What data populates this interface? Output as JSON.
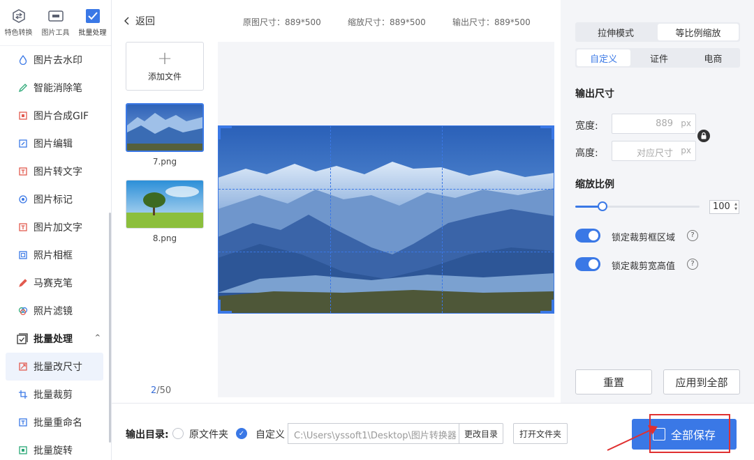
{
  "top_tabs": [
    {
      "label": "特色转换",
      "icon": "swap-icon",
      "active": false
    },
    {
      "label": "图片工具",
      "icon": "toolbox-icon",
      "active": false
    },
    {
      "label": "批量处理",
      "icon": "batch-check-icon",
      "active": true
    }
  ],
  "menu": {
    "items": [
      {
        "label": "图片去水印",
        "icon": "drop-icon"
      },
      {
        "label": "智能消除笔",
        "icon": "pen-icon"
      },
      {
        "label": "图片合成GIF",
        "icon": "gif-icon"
      },
      {
        "label": "图片编辑",
        "icon": "edit-icon"
      },
      {
        "label": "图片转文字",
        "icon": "text-icon"
      },
      {
        "label": "图片标记",
        "icon": "mark-icon"
      },
      {
        "label": "图片加文字",
        "icon": "add-text-icon"
      },
      {
        "label": "照片相框",
        "icon": "frame-icon"
      },
      {
        "label": "马赛克笔",
        "icon": "mosaic-pen-icon"
      },
      {
        "label": "照片滤镜",
        "icon": "filter-icon"
      }
    ],
    "section": {
      "label": "批量处理",
      "caret": "^"
    },
    "sub_items": [
      {
        "label": "批量改尺寸",
        "icon": "resize-icon",
        "active": true
      },
      {
        "label": "批量裁剪",
        "icon": "crop-icon",
        "active": false
      },
      {
        "label": "批量重命名",
        "icon": "rename-icon",
        "active": false
      },
      {
        "label": "批量旋转",
        "icon": "rotate-icon",
        "active": false
      }
    ]
  },
  "header": {
    "back_label": "返回",
    "original_size": "原图尺寸：889*500",
    "scaled_size": "缩放尺寸：889*500",
    "output_size": "输出尺寸：889*500"
  },
  "files": {
    "add_label": "添加文件",
    "items": [
      {
        "name": "7.png",
        "selected": true
      },
      {
        "name": "8.png",
        "selected": false
      }
    ],
    "current": "2",
    "total": "/50"
  },
  "settings": {
    "mode_tabs": [
      {
        "label": "拉伸模式",
        "active": false
      },
      {
        "label": "等比例缩放",
        "active": true
      }
    ],
    "preset_tabs": [
      {
        "label": "自定义",
        "active": true
      },
      {
        "label": "证件",
        "active": false
      },
      {
        "label": "电商",
        "active": false
      }
    ],
    "output_size_title": "输出尺寸",
    "width_label": "宽度:",
    "width_value": "889",
    "height_label": "高度:",
    "height_placeholder": "对应尺寸",
    "unit": "px",
    "scale_title": "缩放比例",
    "scale_value": "100",
    "scale_fraction": 0.22,
    "lock_crop_label": "锁定裁剪框区域",
    "lock_ratio_label": "锁定裁剪宽高值",
    "help_glyph": "?",
    "reset_label": "重置",
    "apply_all_label": "应用到全部"
  },
  "bottom": {
    "output_dir_label": "输出目录:",
    "option_original": "原文件夹",
    "option_custom": "自定义",
    "path": "C:\\Users\\yssoft1\\Desktop\\图片转换器",
    "change_dir_label": "更改目录",
    "open_folder_label": "打开文件夹",
    "save_all_label": "全部保存"
  },
  "colors": {
    "accent": "#3a78e6",
    "annotation": "#e03030"
  }
}
